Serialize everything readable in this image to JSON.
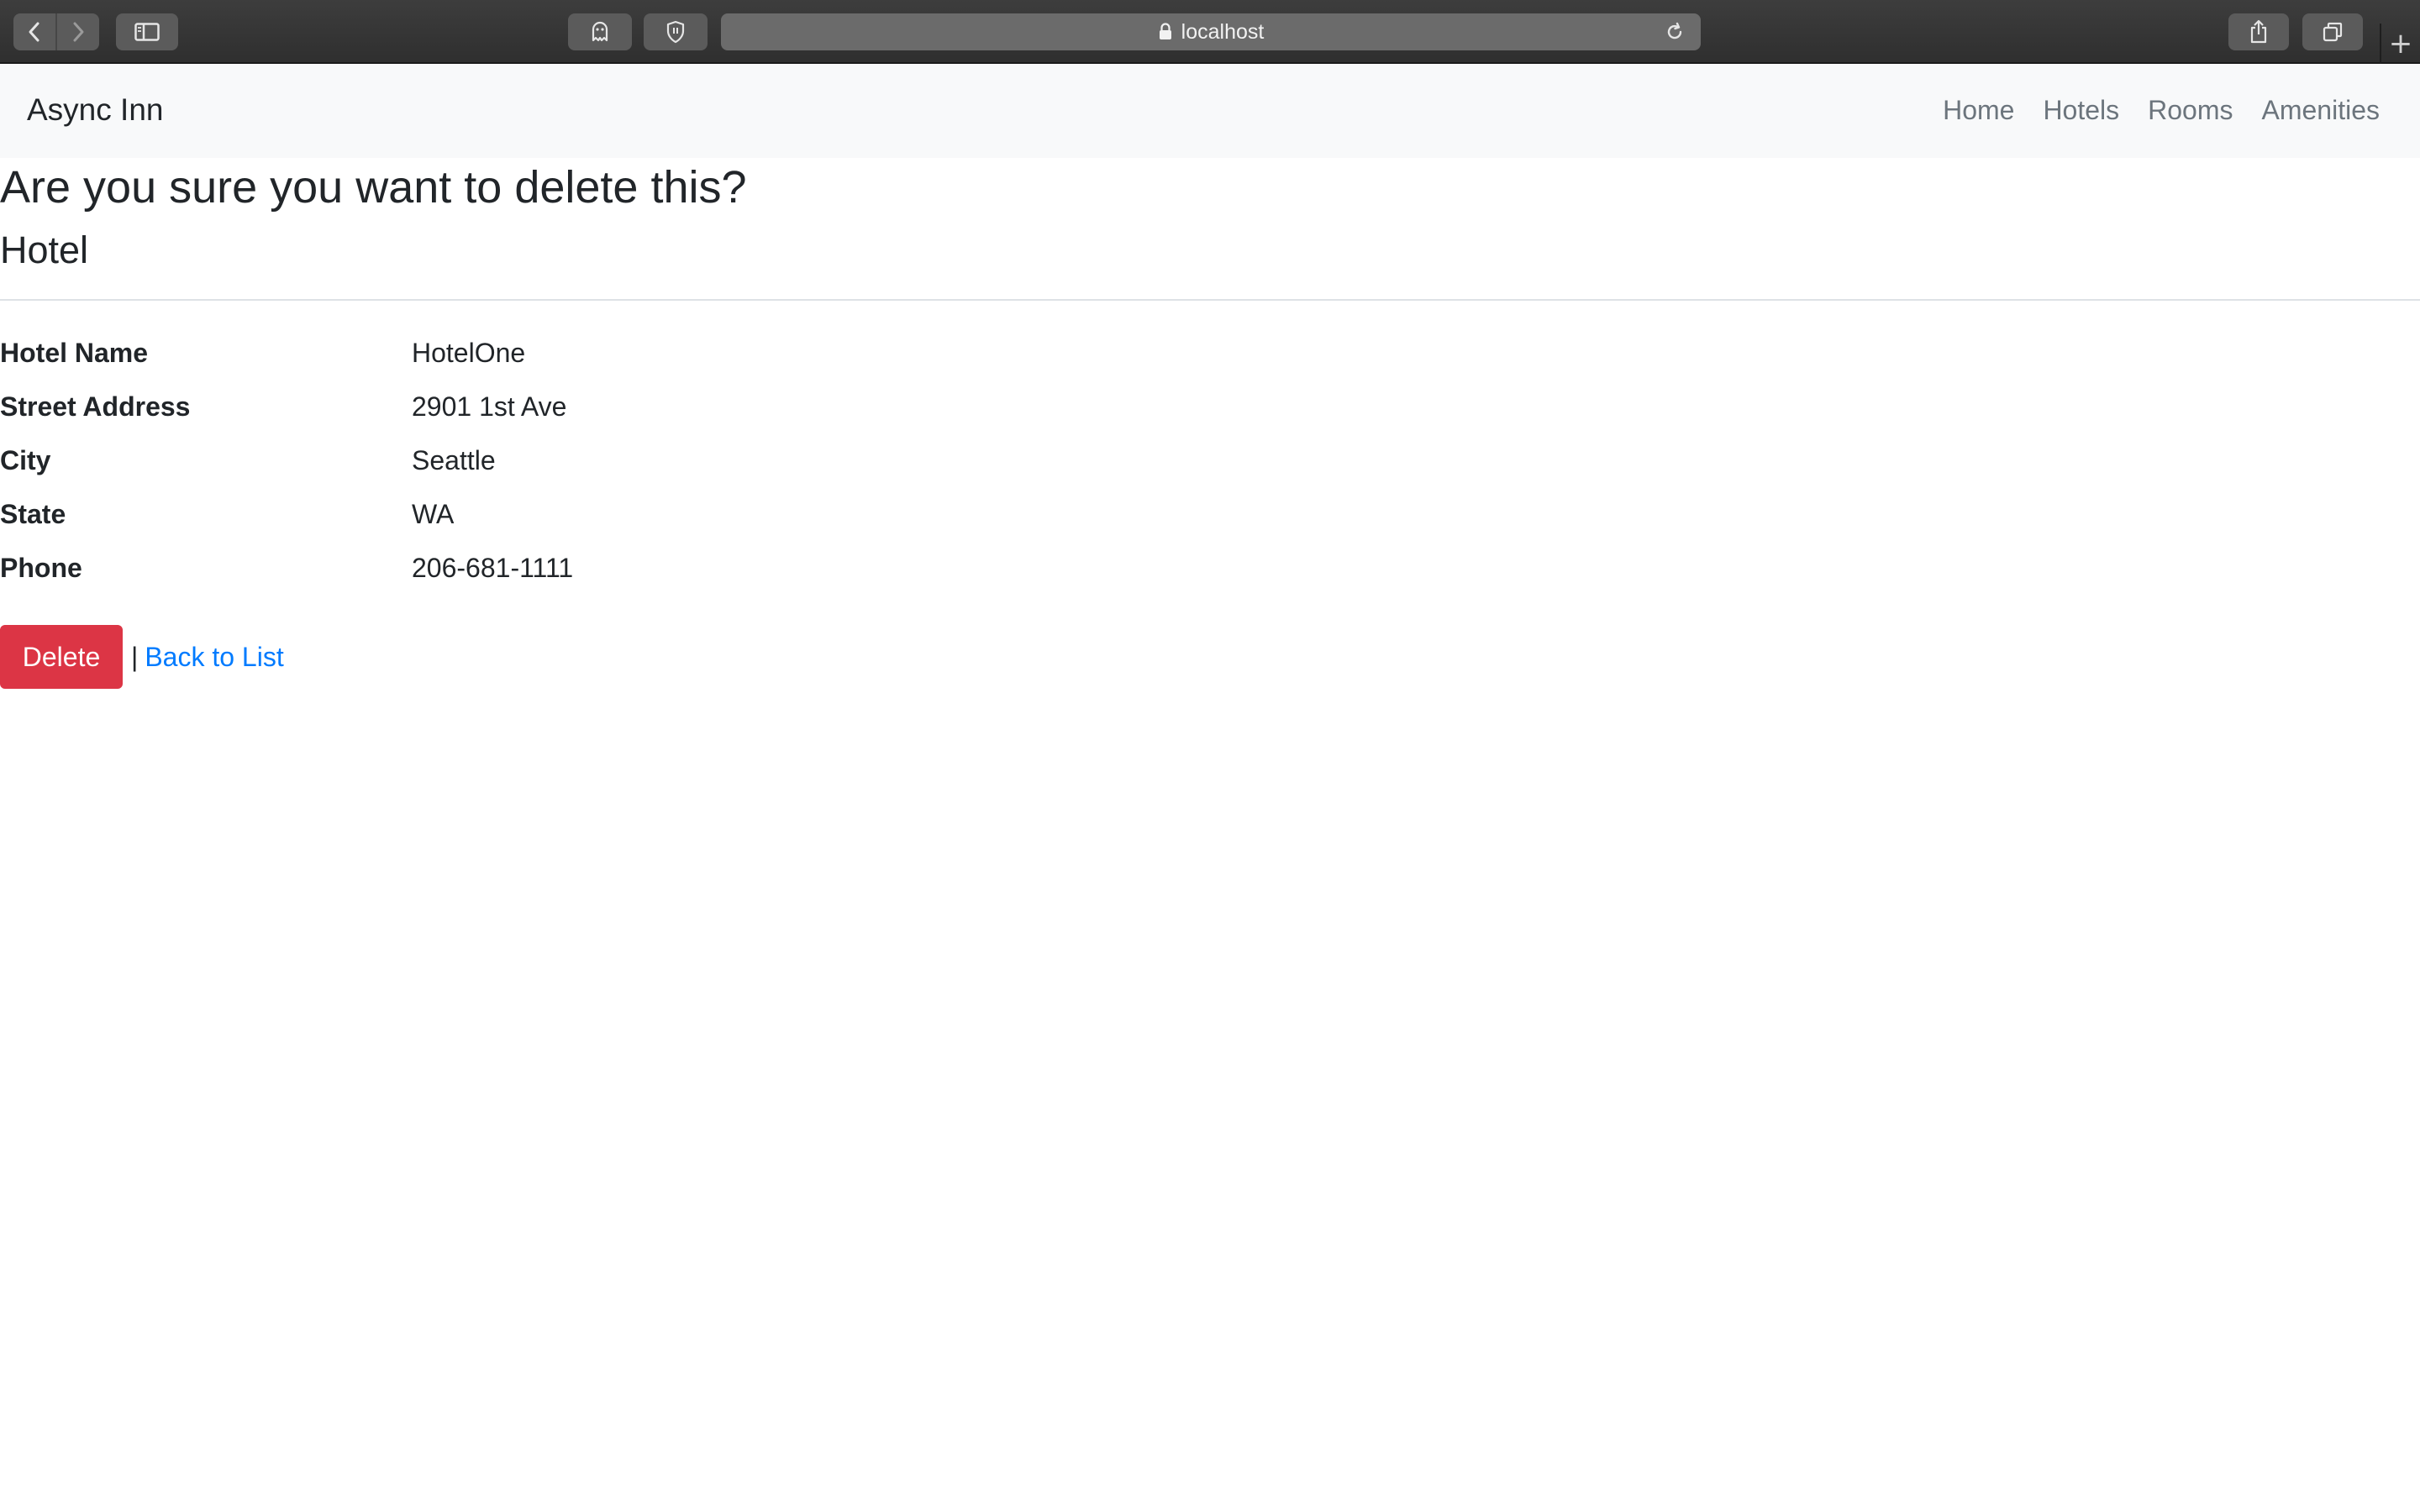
{
  "browser": {
    "url": "localhost",
    "icons": {
      "back": "chevron-left-icon",
      "forward": "chevron-right-icon",
      "sidebar": "sidebar-icon",
      "ghostery": "ghost-icon",
      "shield": "shield-icon",
      "lock": "lock-icon",
      "reload": "reload-icon",
      "share": "share-icon",
      "tabs": "tabs-icon",
      "new_tab": "plus-icon"
    },
    "new_tab_glyph": "+"
  },
  "navbar": {
    "brand": "Async Inn",
    "links": [
      "Home",
      "Hotels",
      "Rooms",
      "Amenities"
    ]
  },
  "page": {
    "question": "Are you sure you want to delete this?",
    "entity": "Hotel",
    "fields": [
      {
        "label": "Hotel Name",
        "value": "HotelOne"
      },
      {
        "label": "Street Address",
        "value": "2901 1st Ave"
      },
      {
        "label": "City",
        "value": "Seattle"
      },
      {
        "label": "State",
        "value": "WA"
      },
      {
        "label": "Phone",
        "value": "206-681-1111"
      }
    ],
    "delete_label": "Delete",
    "separator": "|",
    "back_label": "Back to List"
  },
  "colors": {
    "danger": "#dc3545",
    "link": "#007bff",
    "navbar_bg": "#f8f9fa",
    "nav_link": "#6c757d"
  }
}
